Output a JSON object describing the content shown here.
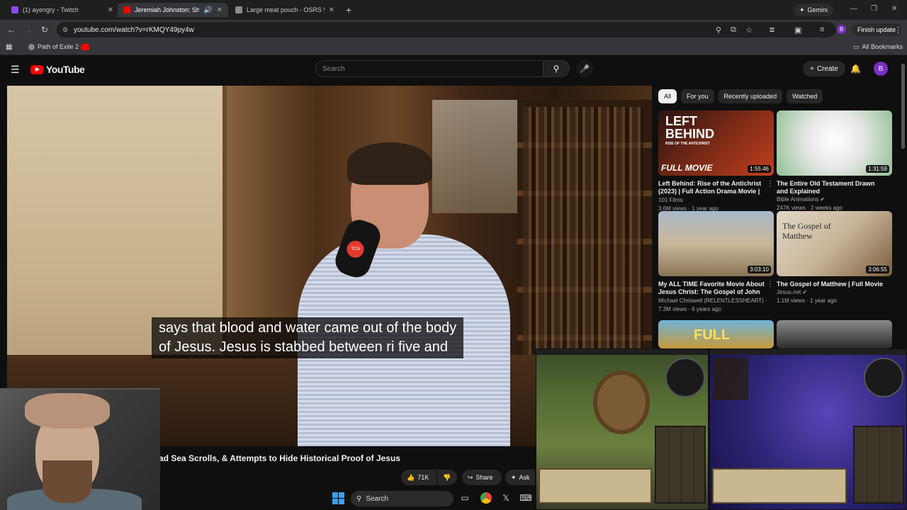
{
  "browser": {
    "tabs": [
      {
        "title": "(1) ayengry - Twitch",
        "color": "#9146ff"
      },
      {
        "title": "Jeremiah Johnston: Shroud",
        "color": "#ff0000",
        "active": true
      },
      {
        "title": "Large meat pouch - OSRS Wiki",
        "color": "#8a8a8a"
      }
    ],
    "new_tab": "+",
    "gemini_label": "Gemini",
    "url": "youtube.com/watch?v=rKMQY49py4w",
    "finish_update": "Finish update",
    "profile_initial": "B",
    "bookmarks": [
      {
        "label": "Path of Exile 2"
      }
    ],
    "all_bookmarks": "All Bookmarks"
  },
  "youtube": {
    "logo_text": "YouTube",
    "search_placeholder": "Search",
    "create_label": "Create",
    "avatar_initial": "B",
    "video": {
      "subtitle_line1": "says that blood and water came out of the body",
      "subtitle_line2": "of Jesus. Jesus is stabbed between ri five and",
      "title": "ad Sea Scrolls, & Attempts to Hide Historical Proof of Jesus",
      "likes": "71K",
      "share_label": "Share",
      "ask_label": "Ask",
      "mic_badge": "TCN"
    },
    "chips": [
      "All",
      "For you",
      "Recently uploaded",
      "Watched"
    ],
    "recommendations": [
      {
        "title": "Left Behind: Rise of the Antichrist (2023) | Full Action Drama Movie | ...",
        "channel": "101 Films",
        "meta": "3.6M views · 1 year ago",
        "duration": "1:55:46",
        "thumb_line1": "LEFT",
        "thumb_line2": "BEHIND",
        "thumb_sub": "RISE OF THE ANTICHRIST",
        "thumb_badge": "FULL MOVIE"
      },
      {
        "title": "The Entire Old Testament Drawn and Explained",
        "channel": "Bible Animations ✔",
        "meta": "247K views · 2 weeks ago",
        "duration": "1:31:59"
      },
      {
        "title": "My ALL TIME Favorite Movie About Jesus Christ: The Gospel of John HD",
        "channel": "Michael Chriswell (RELENTLESSHEART) ·",
        "meta": "7.3M views · 6 years ago",
        "duration": "3:03:10"
      },
      {
        "title": "The Gospel of Matthew | Full Movie",
        "channel": "Jesus.net ✔",
        "meta": "1.1M views · 1 year ago",
        "duration": "3:06:55",
        "thumb_text": "The Gospel of Matthew"
      },
      {
        "title": "",
        "channel": "",
        "meta": "",
        "duration": "",
        "thumb_text": "FULL"
      },
      {
        "title": "",
        "channel": "",
        "meta": "",
        "duration": ""
      }
    ]
  },
  "taskbar": {
    "search_label": "Search"
  },
  "colors": {
    "yt_red": "#ff0000",
    "chip_active_bg": "#f1f1f1",
    "bg": "#0f0f0f"
  }
}
